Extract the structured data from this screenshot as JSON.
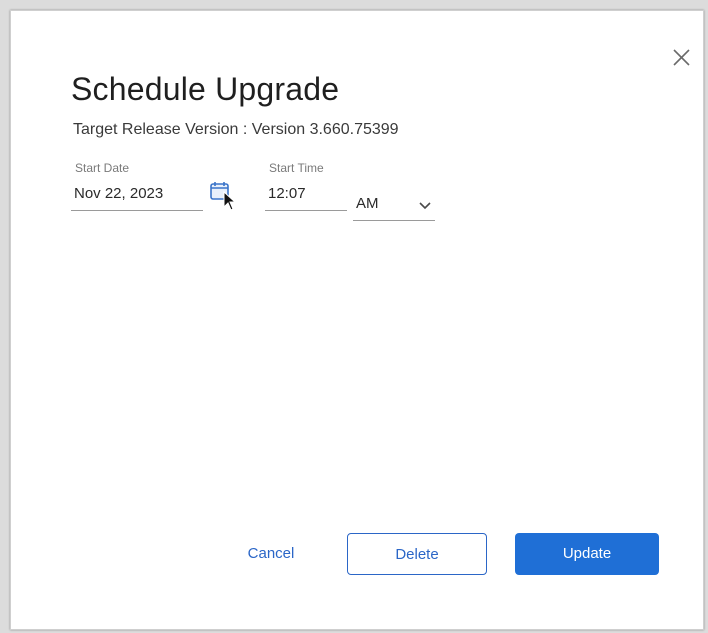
{
  "dialog": {
    "title": "Schedule Upgrade",
    "subtitle": "Target Release Version : Version 3.660.75399"
  },
  "form": {
    "start_date": {
      "label": "Start Date",
      "value": "Nov 22, 2023"
    },
    "start_time": {
      "label": "Start Time",
      "value": "12:07"
    },
    "meridiem": {
      "value": "AM"
    }
  },
  "actions": {
    "cancel_label": "Cancel",
    "delete_label": "Delete",
    "update_label": "Update"
  },
  "icons": {
    "close": "close-icon",
    "calendar": "calendar-icon",
    "dropdown": "chevron-down-icon",
    "cursor": "mouse-pointer-icon"
  },
  "colors": {
    "accent": "#1f6fd6",
    "link": "#2b66c7",
    "text": "#1f1f1f"
  }
}
